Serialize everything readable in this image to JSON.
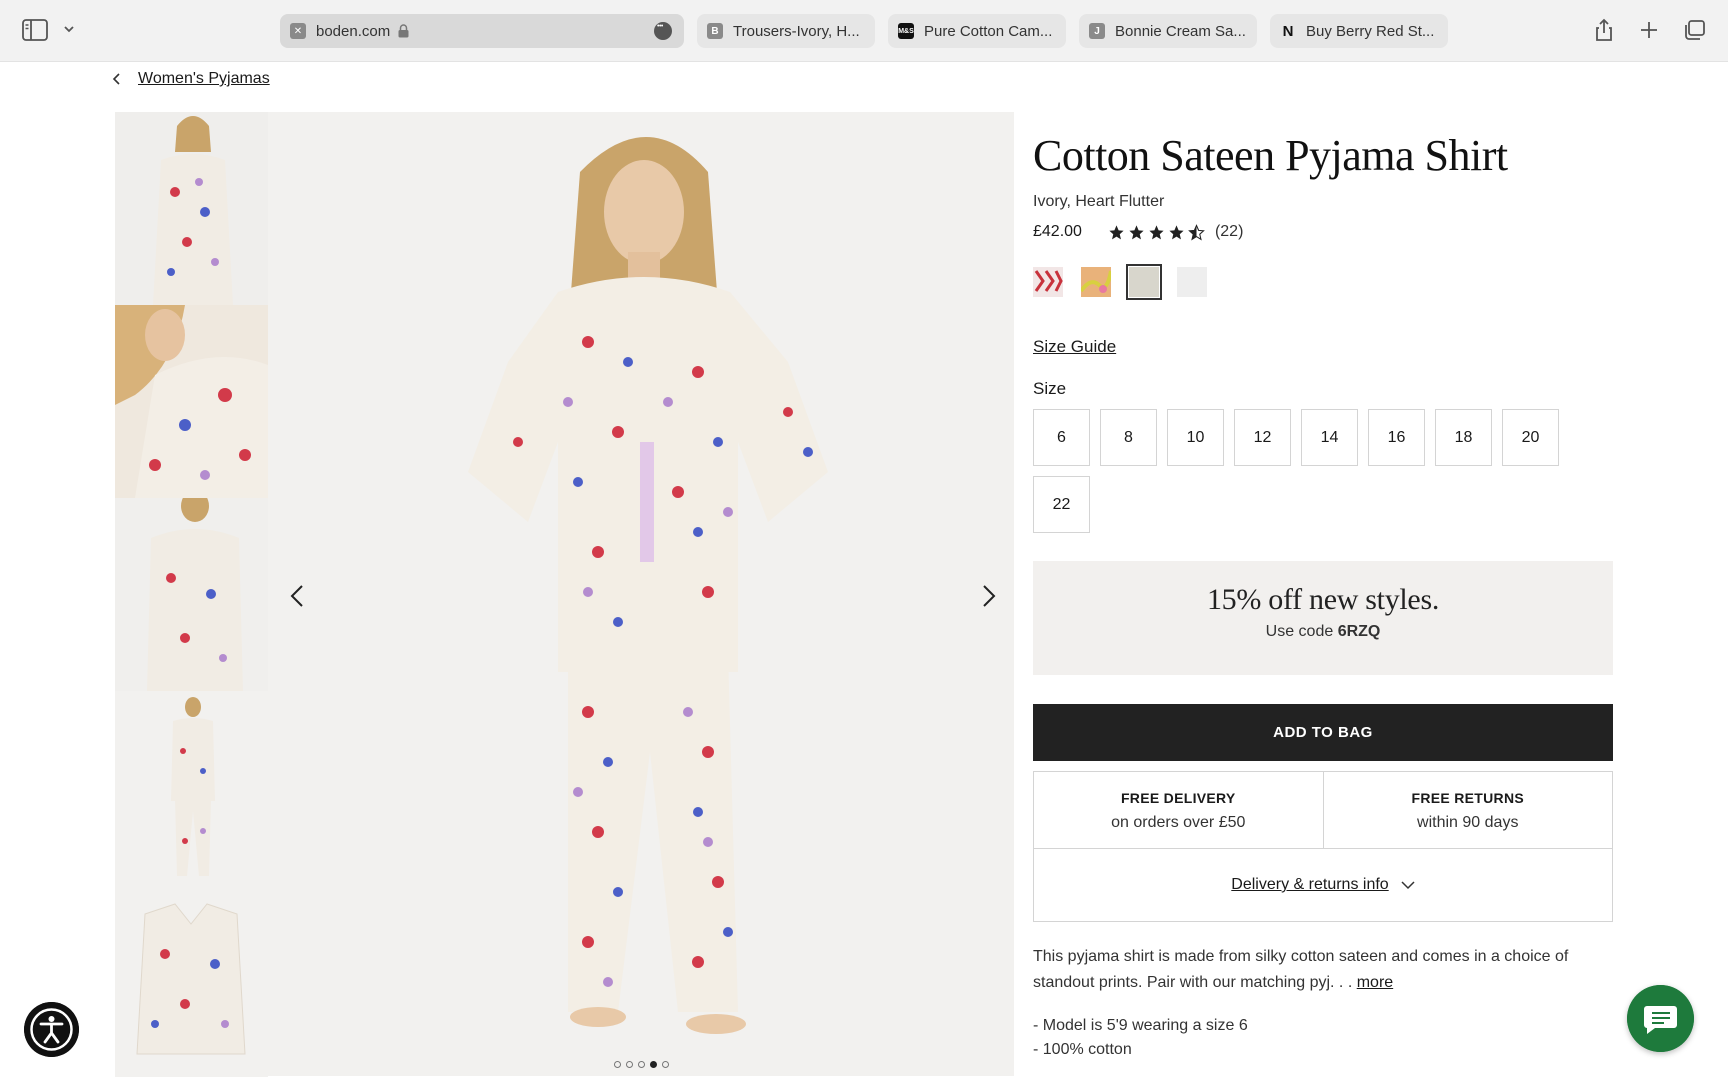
{
  "browser": {
    "tabs": [
      {
        "label": "boden.com",
        "favicon": "x-favicon",
        "active": true
      },
      {
        "label": "Trousers-Ivory, H...",
        "favicon": "B"
      },
      {
        "label": "Pure Cotton Cam...",
        "favicon": "M&S"
      },
      {
        "label": "Bonnie Cream Sa...",
        "favicon": "J"
      },
      {
        "label": "Buy Berry Red St...",
        "favicon": "N"
      }
    ],
    "icons": [
      "sidebar-icon",
      "chevron-down-icon",
      "lock-icon",
      "more-icon",
      "share-icon",
      "plus-icon",
      "tabs-overview-icon"
    ]
  },
  "breadcrumb": {
    "label": "Women's Pyjamas"
  },
  "gallery": {
    "thumbnail_count": 5,
    "dots": 5,
    "active_dot": 4
  },
  "product": {
    "title": "Cotton Sateen Pyjama Shirt",
    "color": "Ivory, Heart Flutter",
    "price": "£42.00",
    "rating": 4.5,
    "review_count": "(22)",
    "swatches": [
      {
        "name": "red-print",
        "color": "#c8323c"
      },
      {
        "name": "gold-print",
        "color": "#d9a24a"
      },
      {
        "name": "ivory-heart-flutter",
        "color": "#d8d6cc",
        "selected": true
      },
      {
        "name": "white",
        "color": "#eeeeee"
      }
    ],
    "size_guide": "Size Guide",
    "size_label": "Size",
    "sizes": [
      "6",
      "8",
      "10",
      "12",
      "14",
      "16",
      "18",
      "20",
      "22"
    ]
  },
  "promo": {
    "headline": "15% off new styles.",
    "use_code": "Use code",
    "code": "6RZQ"
  },
  "add_to_bag": "ADD TO BAG",
  "delivery": {
    "free_delivery_title": "FREE DELIVERY",
    "free_delivery_sub": "on orders over £50",
    "free_returns_title": "FREE RETURNS",
    "free_returns_sub": "within 90 days",
    "info_link": "Delivery & returns info"
  },
  "description": {
    "text": "This pyjama shirt is made from silky cotton sateen and comes in a choice of standout prints. Pair with our matching pyj. . .",
    "more": "more",
    "bullets": [
      "- Model is 5'9 wearing a size 6",
      "- 100% cotton"
    ]
  },
  "colors": {
    "accent": "#222222",
    "chat": "#1e7a3c",
    "promo_bg": "#f2f0ee"
  }
}
